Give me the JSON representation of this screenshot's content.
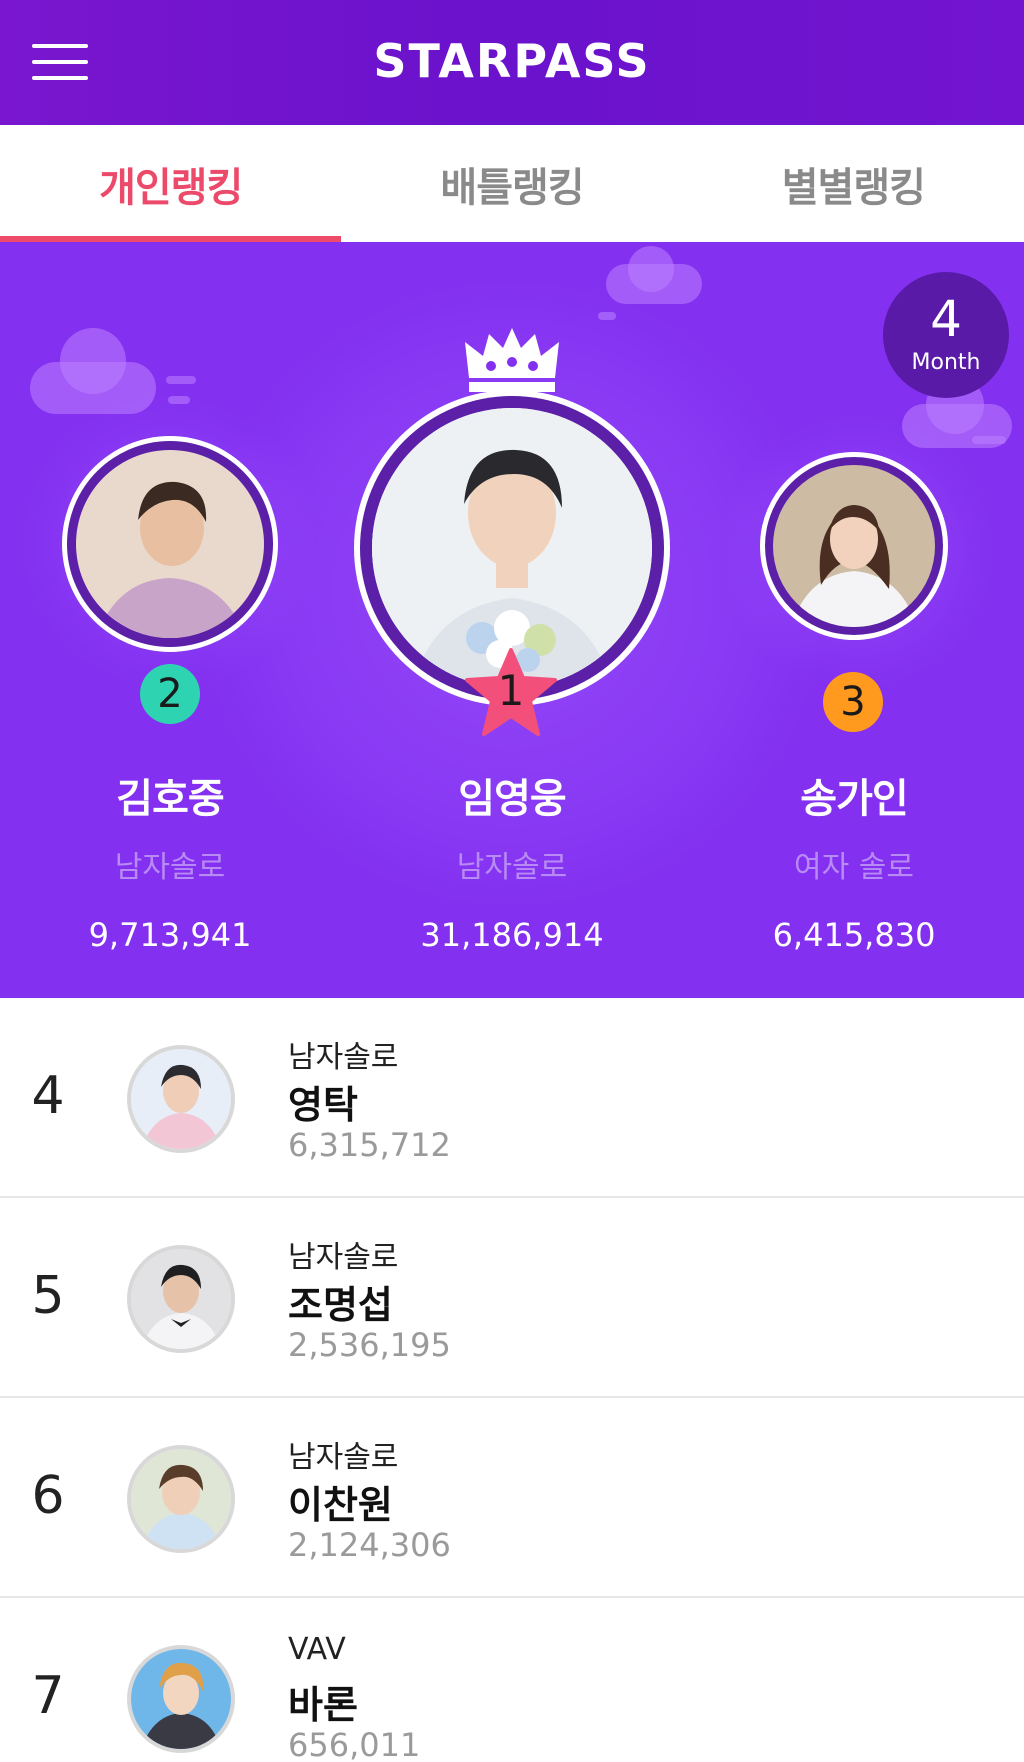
{
  "header": {
    "title": "STARPASS",
    "menu_icon": "hamburger-menu-icon"
  },
  "tabs": [
    {
      "label": "개인랭킹",
      "active": true
    },
    {
      "label": "배틀랭킹",
      "active": false
    },
    {
      "label": "별별랭킹",
      "active": false
    }
  ],
  "month_badge": {
    "number": "4",
    "label": "Month"
  },
  "podium": {
    "first": {
      "rank": "1",
      "name": "임영웅",
      "group": "남자솔로",
      "votes": "31,186,914"
    },
    "second": {
      "rank": "2",
      "name": "김호중",
      "group": "남자솔로",
      "votes": "9,713,941"
    },
    "third": {
      "rank": "3",
      "name": "송가인",
      "group": "여자 솔로",
      "votes": "6,415,830"
    }
  },
  "list": [
    {
      "rank": "4",
      "group": "남자솔로",
      "name": "영탁",
      "votes": "6,315,712"
    },
    {
      "rank": "5",
      "group": "남자솔로",
      "name": "조명섭",
      "votes": "2,536,195"
    },
    {
      "rank": "6",
      "group": "남자솔로",
      "name": "이찬원",
      "votes": "2,124,306"
    },
    {
      "rank": "7",
      "group": "VAV",
      "name": "바론",
      "votes": "656,011"
    }
  ],
  "colors": {
    "header_purple": "#6d13cc",
    "hero_purple": "#8330f0",
    "tab_active": "#ec4a6a",
    "rank2_badge": "#2ed3b2",
    "rank3_badge": "#ff9a1f",
    "rank1_star": "#f2507a"
  }
}
